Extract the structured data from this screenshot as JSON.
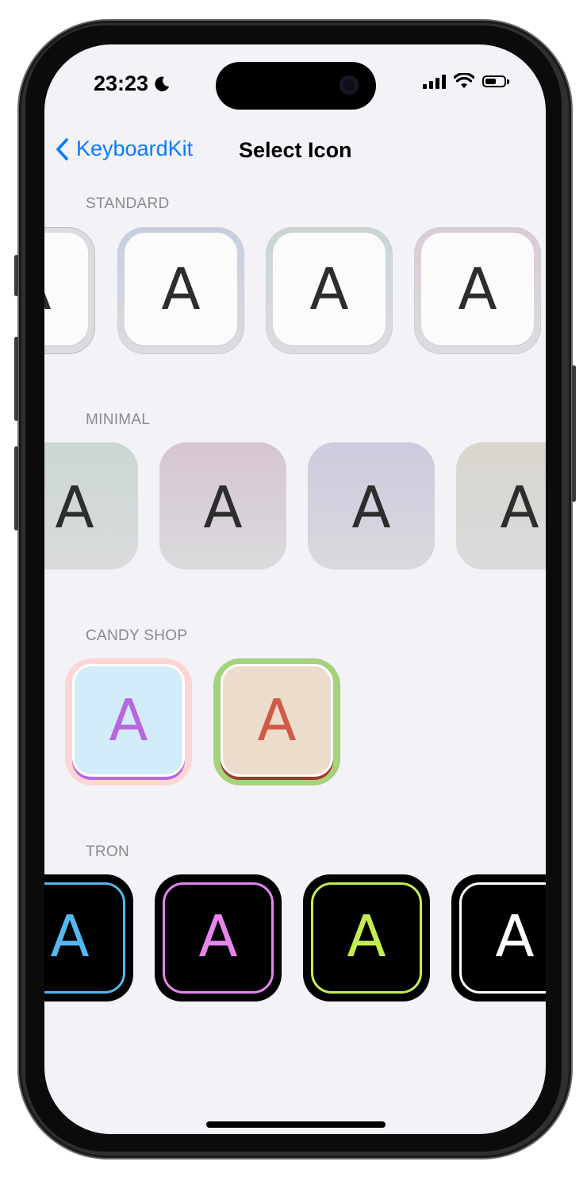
{
  "status_bar": {
    "time": "23:23",
    "icons": [
      "moon-icon",
      "cellular-signal-icon",
      "wifi-icon",
      "battery-icon"
    ]
  },
  "nav": {
    "back_label": "KeyboardKit",
    "title": "Select Icon",
    "back_icon": "chevron-left-icon"
  },
  "sections": [
    {
      "label": "STANDARD",
      "icons": [
        {
          "letter": "A",
          "tint": "#c8c8cc"
        },
        {
          "letter": "A",
          "tint": "#c5cde0"
        },
        {
          "letter": "A",
          "tint": "#c9d6d2"
        },
        {
          "letter": "A",
          "tint": "#d9cbd6"
        }
      ]
    },
    {
      "label": "MINIMAL",
      "icons": [
        {
          "letter": "A",
          "tint": "#cbd7d3"
        },
        {
          "letter": "A",
          "tint": "#d6c6d2"
        },
        {
          "letter": "A",
          "tint": "#cfcade"
        },
        {
          "letter": "A",
          "tint": "#d9d6ce"
        }
      ]
    },
    {
      "label": "CANDY SHOP",
      "icons": [
        {
          "letter": "A",
          "letter_color": "#b767e0",
          "fill": "#d3ecf9",
          "frame": "#fdd5d4",
          "shade": "#b767e0"
        },
        {
          "letter": "A",
          "letter_color": "#d05a45",
          "fill": "#ecdccb",
          "frame": "#a6d27b",
          "shade": "#9b3a2a"
        }
      ]
    },
    {
      "label": "TRON",
      "icons": [
        {
          "letter": "A",
          "color": "#52b8ee"
        },
        {
          "letter": "A",
          "color": "#e685ee"
        },
        {
          "letter": "A",
          "color": "#c3ee52"
        },
        {
          "letter": "A",
          "color": "#ffffff"
        }
      ]
    }
  ]
}
